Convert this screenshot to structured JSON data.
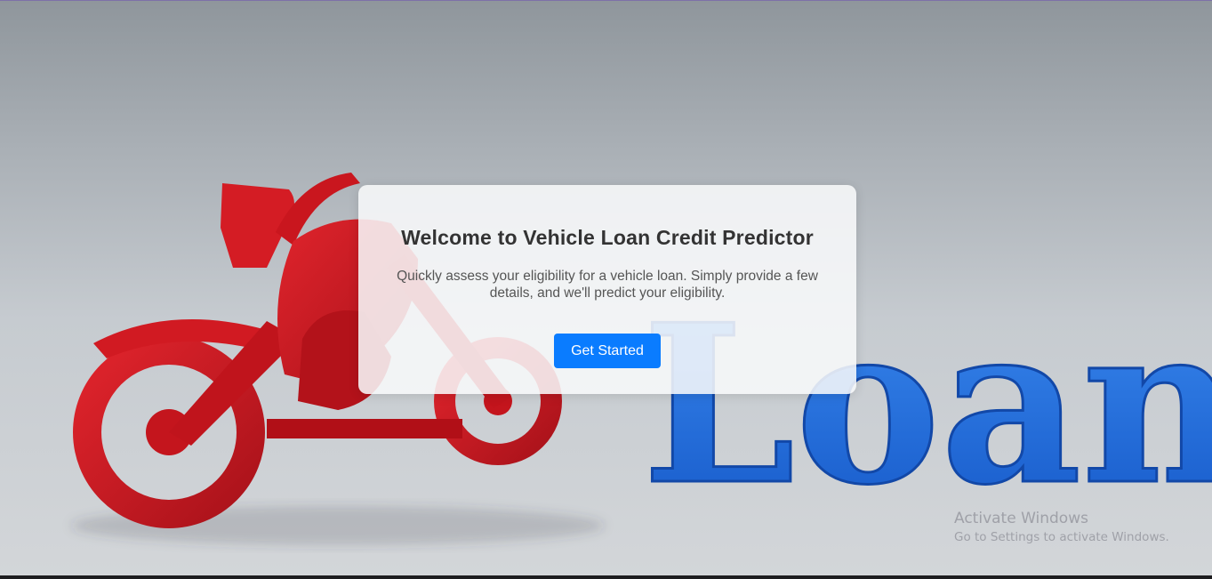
{
  "background": {
    "graphic": "red-motorcycle-and-blue-loan-letters",
    "loan_word": "Loan",
    "colors": {
      "motorcycle": "#d11a22",
      "loan_text": "#1f6fe0"
    }
  },
  "hero": {
    "title": "Welcome to Vehicle Loan Credit Predictor",
    "description": "Quickly assess your eligibility for a vehicle loan. Simply provide a few details, and we'll predict your eligibility.",
    "cta_label": "Get Started",
    "cta_color": "#0a7cff"
  },
  "watermark": {
    "title": "Activate Windows",
    "subtitle": "Go to Settings to activate Windows."
  }
}
